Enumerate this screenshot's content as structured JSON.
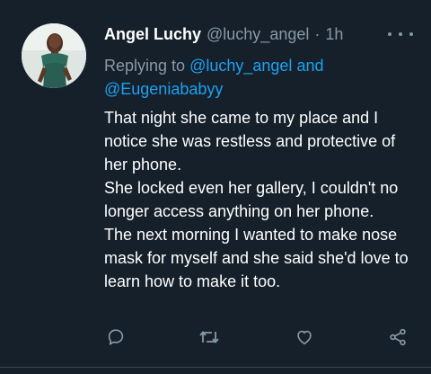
{
  "tweet": {
    "display_name": "Angel Luchy",
    "handle": "@luchy_angel",
    "separator": "·",
    "time": "1h",
    "replying_prefix": "Replying to",
    "replying_mention_1": "@luchy_angel",
    "replying_conjunction": "and",
    "replying_mention_2": "@Eugeniababyy",
    "lines": [
      "That night she came to my place and I notice she was restless and protective of her phone.",
      "She locked even her gallery, I couldn't no longer access anything on her phone.",
      "The next morning I wanted to make nose mask for myself and she said she'd love to learn how to make it too."
    ]
  },
  "icons": {
    "more": "more-dots-icon",
    "reply": "reply-icon",
    "retweet": "retweet-icon",
    "like": "heart-icon",
    "share": "share-icon"
  },
  "colors": {
    "background": "#15202b",
    "text": "#ffffff",
    "muted": "#8899a6",
    "link": "#1da1f2"
  }
}
